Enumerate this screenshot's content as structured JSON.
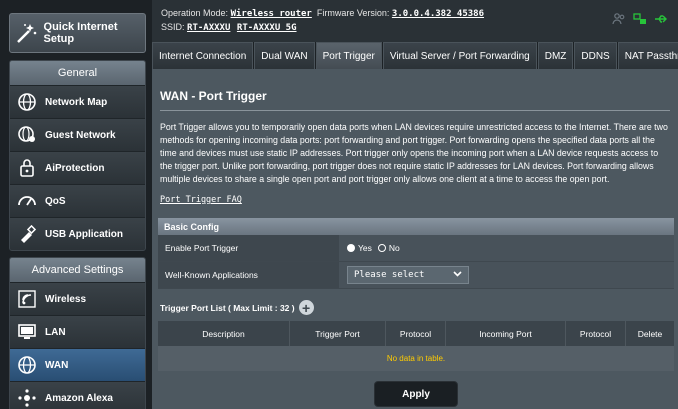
{
  "sidebar": {
    "qis_label": "Quick Internet Setup",
    "general_title": "General",
    "general_items": [
      {
        "label": "Network Map",
        "icon": "globe-icon"
      },
      {
        "label": "Guest Network",
        "icon": "guest-globe-icon"
      },
      {
        "label": "AiProtection",
        "icon": "lock-icon"
      },
      {
        "label": "QoS",
        "icon": "gauge-icon"
      },
      {
        "label": "USB Application",
        "icon": "usb-icon"
      }
    ],
    "advanced_title": "Advanced Settings",
    "advanced_items": [
      {
        "label": "Wireless",
        "icon": "wifi-icon"
      },
      {
        "label": "LAN",
        "icon": "monitor-icon"
      },
      {
        "label": "WAN",
        "icon": "globe-icon"
      },
      {
        "label": "Amazon Alexa",
        "icon": "alexa-icon"
      }
    ],
    "active_item": "WAN"
  },
  "topbar": {
    "mode_label": "Operation Mode:",
    "mode_value": "Wireless router",
    "firmware_label": "Firmware Version:",
    "firmware_value": "3.0.0.4.382_45386",
    "ssid_label": "SSID:",
    "ssid_1": "RT-AXXXU",
    "ssid_2": "RT-AXXXU_5G"
  },
  "tabs": [
    "Internet Connection",
    "Dual WAN",
    "Port Trigger",
    "Virtual Server / Port Forwarding",
    "DMZ",
    "DDNS",
    "NAT Passthrough"
  ],
  "active_tab": "Port Trigger",
  "main": {
    "title": "WAN - Port Trigger",
    "description": "Port Trigger allows you to temporarily open data ports when LAN devices require unrestricted access to the Internet. There are two methods for opening incoming data ports: port forwarding and port trigger. Port forwarding opens the specified data ports all the time and devices must use static IP addresses. Port trigger only opens the incoming port when a LAN device requests access to the trigger port. Unlike port forwarding, port trigger does not require static IP addresses for LAN devices. Port forwarding allows multiple devices to share a single open port and port trigger only allows one client at a time to access the open port.",
    "faq_link": "Port Trigger FAQ",
    "basic_config": {
      "header": "Basic Config",
      "enable_label": "Enable Port Trigger",
      "yes_label": "Yes",
      "no_label": "No",
      "enabled": "No",
      "apps_label": "Well-Known Applications",
      "apps_select": "Please select"
    },
    "trigger_list_label": "Trigger Port List ( Max Limit : 32 )",
    "table": {
      "headers": [
        "Description",
        "Trigger Port",
        "Protocol",
        "Incoming Port",
        "Protocol",
        "Delete"
      ],
      "empty_text": "No data in table."
    },
    "apply_label": "Apply"
  },
  "colors": {
    "accent_active": "#294e73",
    "panel": "#4d5860",
    "empty_text": "#ffcc00"
  }
}
